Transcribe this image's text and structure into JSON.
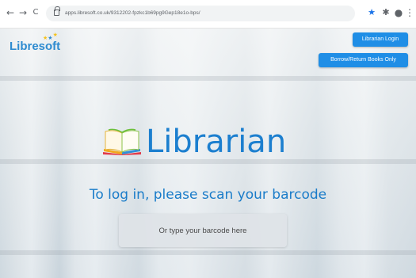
{
  "browser": {
    "url": "apps.libresoft.co.uk/9312202-fpzkc1b69pg9Gep18e1o-bps/",
    "back_glyph": "←",
    "forward_glyph": "→",
    "reload_glyph": "C",
    "star_glyph": "★",
    "extensions_glyph": "✱",
    "profile_glyph": "●",
    "menu_glyph": "⋮",
    "icons": [
      "back-arrow-icon",
      "forward-arrow-icon",
      "reload-icon",
      "lock-icon",
      "bookmark-star-icon",
      "extensions-puzzle-icon",
      "profile-icon",
      "more-menu-icon"
    ]
  },
  "header": {
    "logo_text": "Libresoft",
    "login_label": "Librarian Login",
    "borrow_label": "Borrow/Return Books Only"
  },
  "main": {
    "brand_title": "Librarian",
    "instruction": "To log in, please scan your barcode",
    "barcode_placeholder": "Or type your barcode here"
  },
  "colors": {
    "accent": "#1c7fcf",
    "button": "#1f8ee6",
    "logo_star_yellow": "#f4c21a",
    "logo_star_blue": "#2e8bd0"
  }
}
